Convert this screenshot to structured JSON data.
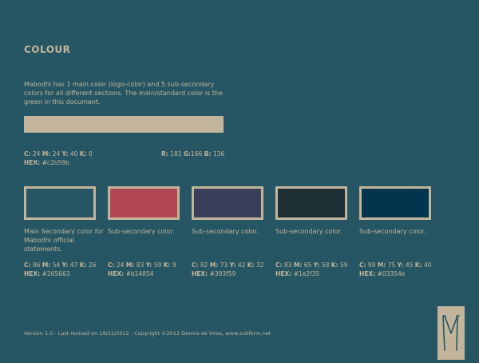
{
  "title": "COLOUR",
  "description": "Mabodhi has 1 main color (logo-color) and 5 sub-secondary colors for all different sections. The main/standard color is the green in this document.",
  "main_color": {
    "hex": "#c2b59b",
    "c": "24",
    "m": "24",
    "y": "40",
    "k": "0",
    "r": "181",
    "g": "166",
    "b": "136"
  },
  "swatches": [
    {
      "label": "Main Secondary color for Mabodhi official statements.",
      "c": "86",
      "m": "54",
      "y": "47",
      "k": "26",
      "hex": "#265663"
    },
    {
      "label": "Sub-secondary color.",
      "c": "24",
      "m": "83",
      "y": "59",
      "k": "9",
      "hex": "#b14854"
    },
    {
      "label": "Sub-secondary color.",
      "c": "82",
      "m": "73",
      "y": "42",
      "k": "32",
      "hex": "#393f59"
    },
    {
      "label": "Sub-secondary color.",
      "c": "83",
      "m": "65",
      "y": "58",
      "k": "59",
      "hex": "#1e2f35"
    },
    {
      "label": "Sub-secondary color.",
      "c": "99",
      "m": "75",
      "y": "45",
      "k": "40",
      "hex": "#03354e"
    }
  ],
  "labels": {
    "c": "C:",
    "m": "M:",
    "y": "Y:",
    "k": "K:",
    "r": "R:",
    "g": "G:",
    "b": "B:",
    "hex": "HEX:"
  },
  "footer": "Version 1.0 - Last revised on 19/11/2012 - Copyright ©2012 Dennis de Vries, www.subform.net",
  "logo_icon": "m-logo-icon"
}
